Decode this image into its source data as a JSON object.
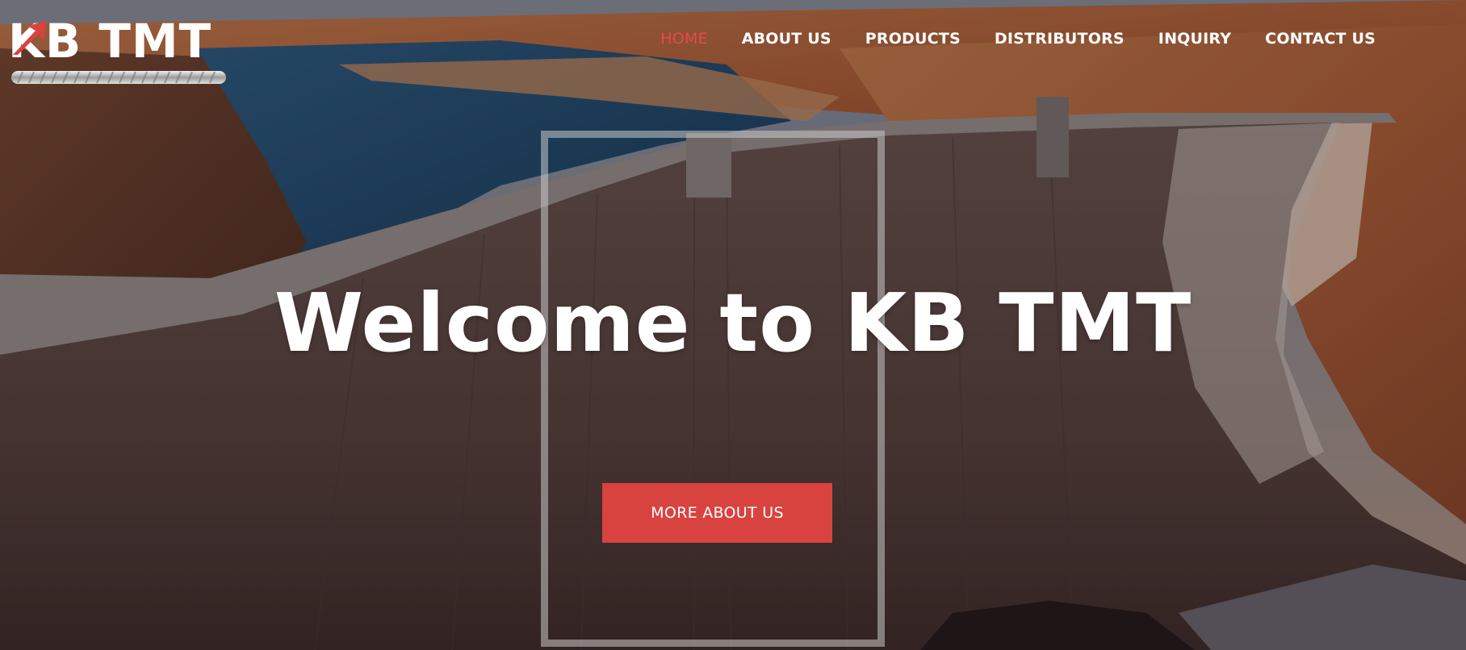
{
  "brand": {
    "name": "KB TMT",
    "logo_icon": "red-arrow-logo-icon",
    "accent_color": "#d9433f"
  },
  "nav": {
    "items": [
      {
        "label": "HOME",
        "active": true
      },
      {
        "label": "ABOUT US",
        "active": false
      },
      {
        "label": "PRODUCTS",
        "active": false
      },
      {
        "label": "DISTRIBUTORS",
        "active": false
      },
      {
        "label": "INQUIRY",
        "active": false
      },
      {
        "label": "CONTACT US",
        "active": false
      }
    ]
  },
  "hero": {
    "headline": "Welcome to KB TMT",
    "cta_label": "MORE ABOUT US",
    "background": "dam-canyon-photo"
  }
}
